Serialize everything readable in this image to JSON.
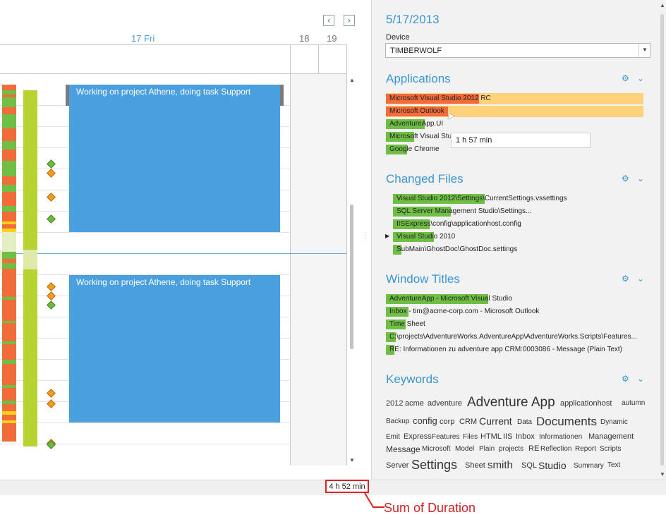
{
  "calendar": {
    "day_main": "17 Fri",
    "day_18": "18",
    "day_19": "19",
    "nav_prev": "‹",
    "nav_next": "›",
    "events": [
      {
        "text": "Working on project Athene, doing task Support"
      },
      {
        "text": "Working on project Athene, doing task Support"
      }
    ]
  },
  "sidebar": {
    "date": "5/17/2013",
    "device_label": "Device",
    "device_value": "TIMBERWOLF",
    "applications": {
      "title": "Applications",
      "items": [
        {
          "label": "Microsoft Visual Studio 2012 RC"
        },
        {
          "label": "Microsoft Outlook"
        },
        {
          "label": "AdventureApp.UI"
        },
        {
          "label": "Microsoft Visual Stu"
        },
        {
          "label": "Google Chrome"
        }
      ],
      "tooltip": "1 h 57 min"
    },
    "changed_files": {
      "title": "Changed Files",
      "items": [
        {
          "label": "Visual Studio 2012\\Settings\\CurrentSettings.vssettings"
        },
        {
          "label": "SQL Server Management Studio\\Settings..."
        },
        {
          "label": "IISExpress\\config\\applicationhost.config"
        },
        {
          "label": "Visual Studio 2010"
        },
        {
          "label": "SubMain\\GhostDoc\\GhostDoc.settings"
        }
      ]
    },
    "window_titles": {
      "title": "Window Titles",
      "items": [
        {
          "label": "AdventureApp - Microsoft Visual Studio"
        },
        {
          "label": "Inbox - tim@acme-corp.com - Microsoft Outlook"
        },
        {
          "label": "Time Sheet"
        },
        {
          "label": "C:\\projects\\AdventureWorks.AdventureApp\\AdventureWorks.Scripts\\Features..."
        },
        {
          "label": "RE: Informationen zu adventure app CRM:0003086 - Message (Plain Text)"
        }
      ]
    },
    "keywords": {
      "title": "Keywords",
      "words": [
        "2012",
        "acme",
        "adventure",
        "Adventure App",
        "applicationhost",
        "autumn",
        "Backup",
        "config",
        "corp",
        "CRM",
        "Current",
        "Data",
        "Documents",
        "Dynamic",
        "Emit",
        "Express",
        "Features",
        "Files",
        "HTML",
        "IIS",
        "Inbox",
        "Informationen",
        "Management",
        "Message",
        "Microsoft",
        "Model",
        "Plain",
        "projects",
        "RE",
        "Reflection",
        "Report",
        "Scripts",
        "Server",
        "Settings",
        "Sheet",
        "smith",
        "SQL",
        "Studio",
        "Summary",
        "Text"
      ]
    },
    "gear_icon": "gear-icon",
    "chevron_icon": "chevron-down-icon"
  },
  "status": {
    "sum_of_duration": "4 h 52 min"
  },
  "annotation": {
    "label": "Sum of Duration"
  },
  "colors": {
    "accent": "#3a96cf",
    "event": "#4aa0de",
    "highlight_orange": "#fdd27a",
    "bar_red": "#f26b3a",
    "bar_green": "#6fbf44",
    "lime": "#b7d332",
    "annotation_red": "#e02020"
  }
}
